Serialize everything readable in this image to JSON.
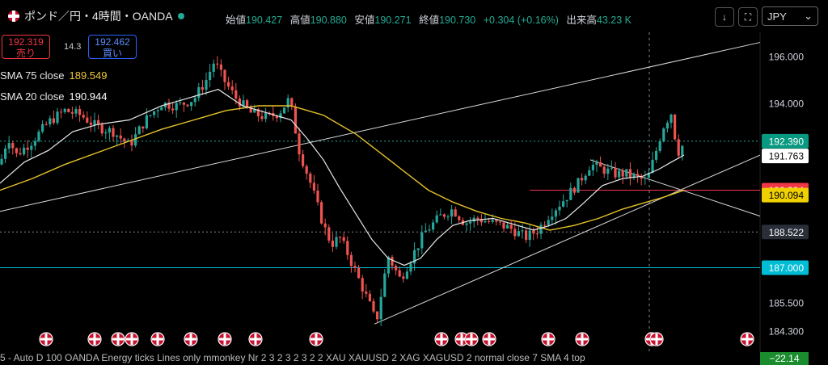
{
  "header": {
    "title": "ポンド／円・4時間・OANDA",
    "labels": {
      "open": "始値",
      "high": "高値",
      "low": "安値",
      "close": "終値",
      "volume": "出来高"
    },
    "open": "190.427",
    "high": "190.880",
    "low": "190.271",
    "close": "190.730",
    "change": "+0.304 (+0.16%)",
    "volume": "43.23 K",
    "currency": "JPY"
  },
  "trade": {
    "sell_price": "192.319",
    "sell_label": "売り",
    "buy_price": "192.462",
    "buy_label": "買い",
    "spread": "14.3"
  },
  "indicators": [
    {
      "label": "SMA 75 close",
      "value": "189.549",
      "color": "#f0c83c"
    },
    {
      "label": "SMA 20 close",
      "value": "190.944",
      "color": "#ffffff"
    }
  ],
  "bottom_text": "5 - Auto D 100 OANDA Energy ticks Lines only mmonkey Nr 2 3 2 3 2 3 2 2 XAU XAUUSD 2 XAG XAGUSD 2 normal close 7 SMA 4 top",
  "bottom_delta": "−22.14",
  "colors": {
    "up": "#26a69a",
    "down": "#ef5350",
    "sma75": "#e6c229",
    "sma20": "#e8e8e8",
    "grid": "#2a2e39"
  },
  "chart_data": {
    "type": "candlestick",
    "y_ticks": [
      "196.000",
      "194.000",
      "192.390",
      "191.763",
      "190.304",
      "190.094",
      "188.522",
      "187.000",
      "185.500",
      "184.300"
    ],
    "price_labels": [
      {
        "value": "192.390",
        "bg": "#089981",
        "fg": "#ffffff"
      },
      {
        "value": "191.763",
        "bg": "#ffffff",
        "fg": "#000000"
      },
      {
        "value": "190.304",
        "bg": "#f23645",
        "fg": "#ffffff"
      },
      {
        "value": "190.094",
        "bg": "#f0d000",
        "fg": "#000000"
      },
      {
        "value": "188.522",
        "bg": "#2a2e39",
        "fg": "#ffffff"
      },
      {
        "value": "187.000",
        "bg": "#00bcd4",
        "fg": "#ffffff"
      },
      {
        "value": "185.500",
        "bg": "",
        "fg": "#d1d4dc"
      },
      {
        "value": "184.300",
        "bg": "",
        "fg": "#d1d4dc"
      }
    ],
    "hlines": [
      {
        "price": 190.304,
        "color": "#f23645",
        "style": "solid"
      },
      {
        "price": 188.522,
        "color": "#888888",
        "style": "dotted"
      },
      {
        "price": 187.0,
        "color": "#00bcd4",
        "style": "solid"
      },
      {
        "price": 192.39,
        "color": "#26a69a",
        "style": "dotted"
      }
    ],
    "close_path": [
      [
        0,
        191.4
      ],
      [
        10,
        192.6
      ],
      [
        20,
        191.8
      ],
      [
        40,
        192.4
      ],
      [
        60,
        193.2
      ],
      [
        80,
        193.7
      ],
      [
        100,
        193.5
      ],
      [
        120,
        193.0
      ],
      [
        140,
        192.8
      ],
      [
        160,
        192.2
      ],
      [
        180,
        193.3
      ],
      [
        200,
        194.0
      ],
      [
        220,
        193.9
      ],
      [
        240,
        194.2
      ],
      [
        255,
        195.0
      ],
      [
        265,
        195.8
      ],
      [
        275,
        195.1
      ],
      [
        290,
        194.3
      ],
      [
        310,
        193.6
      ],
      [
        330,
        193.4
      ],
      [
        345,
        193.6
      ],
      [
        358,
        194.2
      ],
      [
        370,
        192.0
      ],
      [
        385,
        190.5
      ],
      [
        400,
        188.8
      ],
      [
        410,
        188.0
      ],
      [
        420,
        188.3
      ],
      [
        430,
        187.6
      ],
      [
        445,
        186.4
      ],
      [
        460,
        185.2
      ],
      [
        465,
        184.6
      ],
      [
        470,
        185.6
      ],
      [
        480,
        187.5
      ],
      [
        495,
        186.5
      ],
      [
        510,
        187.5
      ],
      [
        525,
        188.5
      ],
      [
        545,
        189.2
      ],
      [
        560,
        189.5
      ],
      [
        575,
        188.9
      ],
      [
        590,
        189.1
      ],
      [
        610,
        188.9
      ],
      [
        630,
        188.7
      ],
      [
        650,
        188.3
      ],
      [
        665,
        188.6
      ],
      [
        680,
        189.3
      ],
      [
        700,
        190.0
      ],
      [
        715,
        190.6
      ],
      [
        730,
        191.4
      ],
      [
        745,
        191.2
      ],
      [
        760,
        191.0
      ],
      [
        775,
        191.0
      ],
      [
        790,
        190.8
      ],
      [
        800,
        190.7
      ],
      [
        810,
        191.8
      ],
      [
        820,
        193.0
      ],
      [
        830,
        193.6
      ],
      [
        838,
        191.9
      ],
      [
        846,
        192.3
      ]
    ],
    "sma20_path": [
      [
        0,
        190.6
      ],
      [
        30,
        191.5
      ],
      [
        60,
        192.0
      ],
      [
        90,
        192.8
      ],
      [
        120,
        193.1
      ],
      [
        160,
        193.3
      ],
      [
        200,
        193.9
      ],
      [
        240,
        194.3
      ],
      [
        270,
        194.6
      ],
      [
        300,
        193.9
      ],
      [
        330,
        193.6
      ],
      [
        360,
        193.3
      ],
      [
        380,
        192.5
      ],
      [
        400,
        191.6
      ],
      [
        420,
        190.4
      ],
      [
        440,
        189.3
      ],
      [
        460,
        188.2
      ],
      [
        480,
        187.4
      ],
      [
        500,
        187.1
      ],
      [
        520,
        187.4
      ],
      [
        540,
        188.2
      ],
      [
        560,
        188.8
      ],
      [
        580,
        189.0
      ],
      [
        610,
        189.1
      ],
      [
        640,
        188.8
      ],
      [
        660,
        188.6
      ],
      [
        680,
        188.8
      ],
      [
        700,
        189.1
      ],
      [
        720,
        189.7
      ],
      [
        745,
        190.5
      ],
      [
        770,
        190.8
      ],
      [
        795,
        190.9
      ],
      [
        815,
        191.2
      ],
      [
        830,
        191.5
      ],
      [
        846,
        191.8
      ]
    ],
    "sma75_path": [
      [
        0,
        190.3
      ],
      [
        40,
        190.8
      ],
      [
        80,
        191.4
      ],
      [
        120,
        191.9
      ],
      [
        160,
        192.4
      ],
      [
        200,
        192.9
      ],
      [
        240,
        193.3
      ],
      [
        280,
        193.7
      ],
      [
        320,
        193.9
      ],
      [
        360,
        193.9
      ],
      [
        400,
        193.5
      ],
      [
        440,
        192.7
      ],
      [
        470,
        191.9
      ],
      [
        500,
        191.1
      ],
      [
        530,
        190.3
      ],
      [
        560,
        189.8
      ],
      [
        590,
        189.4
      ],
      [
        620,
        189.1
      ],
      [
        650,
        188.9
      ],
      [
        680,
        188.6
      ],
      [
        710,
        188.8
      ],
      [
        740,
        189.1
      ],
      [
        770,
        189.5
      ],
      [
        800,
        189.8
      ],
      [
        820,
        190.0
      ],
      [
        846,
        190.3
      ]
    ],
    "trendlines": [
      {
        "from": [
          0,
          189.4
        ],
        "to": [
          940,
          196.6
        ],
        "color": "#d8d8d8"
      },
      {
        "from": [
          463,
          184.6
        ],
        "to": [
          940,
          191.8
        ],
        "color": "#d8d8d8"
      },
      {
        "from": [
          730,
          191.6
        ],
        "to": [
          940,
          189.2
        ],
        "color": "#d8d8d8"
      }
    ],
    "event_x": [
      57,
      117,
      146,
      163,
      195,
      236,
      278,
      316,
      391,
      546,
      571,
      583,
      605,
      678,
      720,
      806,
      812,
      924
    ],
    "crosshair_x": 803
  }
}
